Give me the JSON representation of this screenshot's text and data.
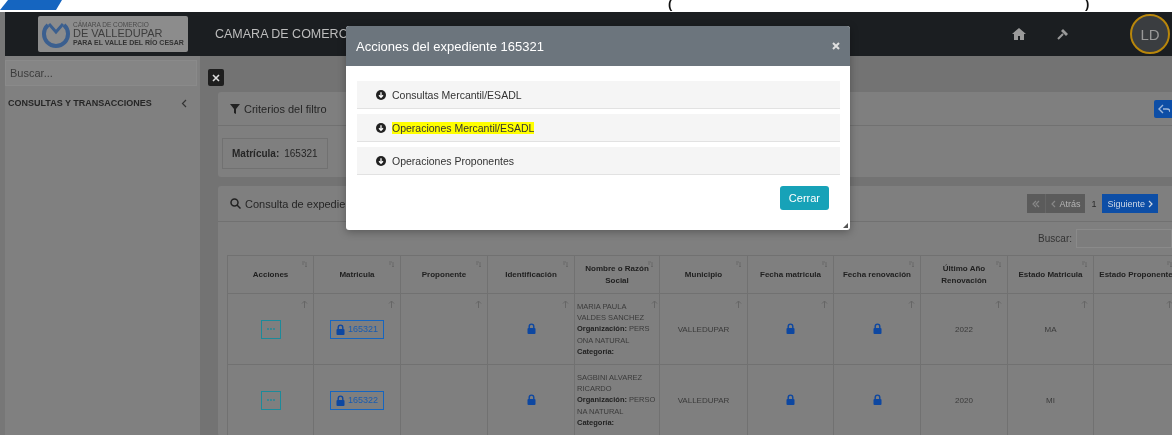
{
  "top_strip": {
    "texts": [
      "(",
      ")"
    ]
  },
  "navbar": {
    "logo": {
      "line1": "CÁMARA DE COMERCIO",
      "line2": "DE VALLEDUPAR",
      "line3": "PARA EL VALLE DEL RÍO CESAR"
    },
    "title": "CAMARA DE COMERC",
    "avatar": "LD"
  },
  "sidebar": {
    "search": {
      "placeholder": "Buscar..."
    },
    "items": [
      {
        "label": "CONSULTAS Y TRANSACCIONES",
        "expanded": false
      }
    ]
  },
  "filter_card": {
    "title": "Criterios del filtro",
    "criteria": [
      {
        "label": "Matrícula:",
        "value": "165321"
      }
    ]
  },
  "results_card": {
    "title": "Consulta de expedie",
    "pagination": {
      "previous": {
        "label": "Atrás",
        "disabled": true
      },
      "page": "1",
      "next": {
        "label": "Siguiente",
        "disabled": false
      }
    },
    "search_label": "Buscar:",
    "table": {
      "columns": [
        "Acciones",
        "Matricula",
        "Proponente",
        "Identificación",
        "Nombre o Razón Social",
        "Municipio",
        "Fecha matricula",
        "Fecha renovación",
        "Último Año Renovación",
        "Estado Matricula",
        "Estado Proponente"
      ],
      "rows": [
        {
          "arrow_marks": true,
          "matricula": "165321",
          "identificacion_locked": true,
          "nombre": "MARIA PAULA VALDES SANCHEZ",
          "organizacion": "**Organización:** PERSONA NATURAL",
          "categoria": "Categoría:",
          "municipio": "VALLEDUPAR",
          "fecha_matricula_locked": true,
          "fecha_renovacion_locked": true,
          "ultimo_ano": "2022",
          "estado_matricula": "MA"
        },
        {
          "arrow_marks": false,
          "matricula": "165322",
          "identificacion_locked": true,
          "nombre": "SAGBINI ALVAREZ RICARDO",
          "organizacion": "**Organización:** PERSONA NATURAL",
          "categoria": "Categoría:",
          "municipio": "VALLEDUPAR",
          "fecha_matricula_locked": true,
          "fecha_renovacion_locked": true,
          "ultimo_ano": "2020",
          "estado_matricula": "MI"
        }
      ]
    }
  },
  "modal": {
    "title": "Acciones del expediente 165321",
    "actions": [
      {
        "label": "Consultas Mercantil/ESADL",
        "highlighted": false
      },
      {
        "label": "Operaciones Mercantil/ESADL",
        "highlighted": true
      },
      {
        "label": "Operaciones Proponentes",
        "highlighted": false
      }
    ],
    "close_button": "Cerrar"
  }
}
